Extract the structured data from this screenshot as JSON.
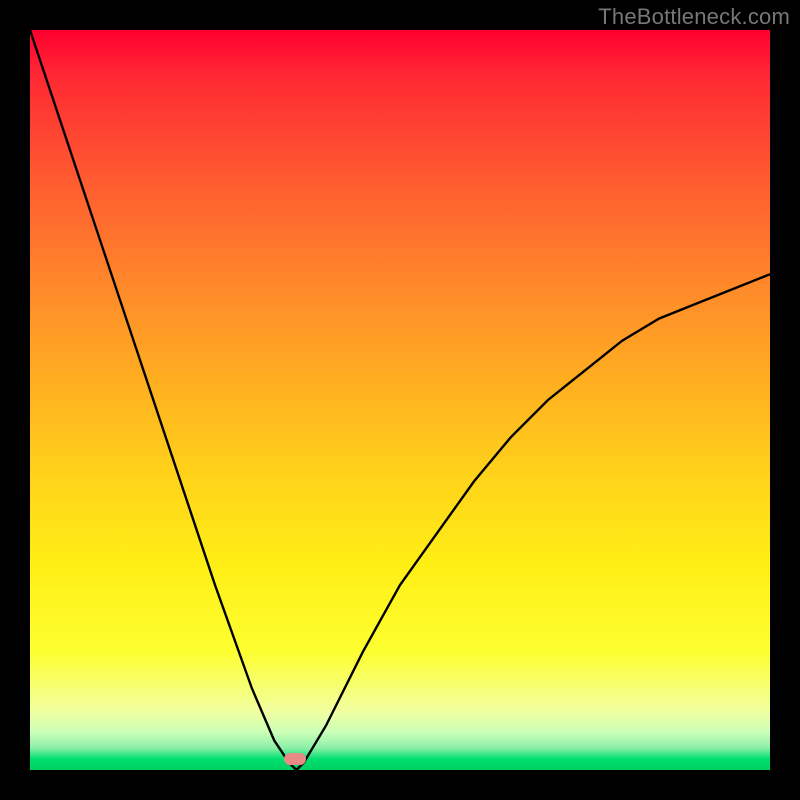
{
  "watermark": "TheBottleneck.com",
  "colors": {
    "page_bg": "#000000",
    "gradient_top": "#ff0030",
    "gradient_bottom": "#00d060",
    "curve": "#000000",
    "marker": "#e88b87",
    "watermark_text": "#777777"
  },
  "chart_data": {
    "type": "line",
    "title": "",
    "xlabel": "",
    "ylabel": "",
    "xlim": [
      0,
      100
    ],
    "ylim": [
      0,
      100
    ],
    "grid": false,
    "legend": false,
    "series": [
      {
        "name": "bottleneck-curve",
        "x": [
          0,
          5,
          10,
          15,
          20,
          25,
          30,
          33,
          35,
          36,
          37,
          40,
          45,
          50,
          55,
          60,
          65,
          70,
          75,
          80,
          85,
          90,
          95,
          100
        ],
        "y": [
          100,
          85,
          70,
          55,
          40,
          25,
          11,
          4,
          1,
          0,
          1,
          6,
          16,
          25,
          32,
          39,
          45,
          50,
          54,
          58,
          61,
          63,
          65,
          67
        ]
      }
    ],
    "annotations": [
      {
        "name": "minimum-marker",
        "x": 36,
        "y": 0
      }
    ]
  }
}
